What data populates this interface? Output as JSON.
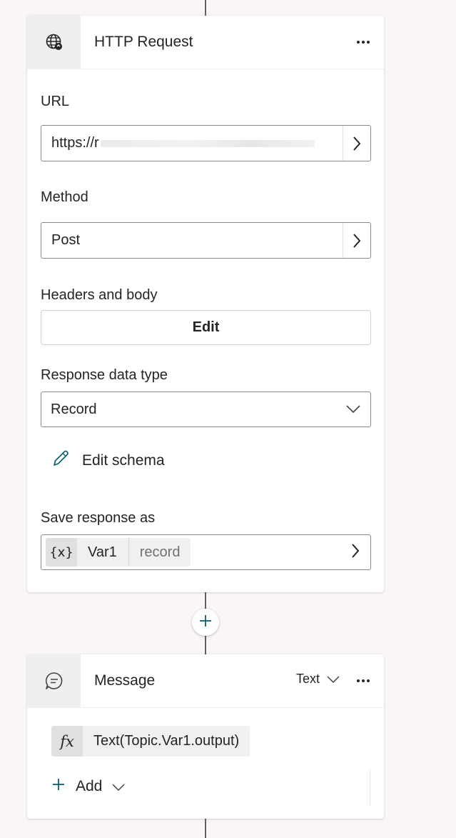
{
  "http_request": {
    "title": "HTTP Request",
    "url_label": "URL",
    "url_value": "https://r",
    "method_label": "Method",
    "method_value": "Post",
    "headers_label": "Headers and body",
    "edit_label": "Edit",
    "response_type_label": "Response data type",
    "response_type_value": "Record",
    "edit_schema_label": "Edit schema",
    "save_response_label": "Save response as",
    "var_icon": "{x}",
    "var_name": "Var1",
    "var_type": "record"
  },
  "message": {
    "title": "Message",
    "type_label": "Text",
    "fx_icon": "fx",
    "expression": "Text(Topic.Var1.output)",
    "add_label": "Add"
  },
  "icons": {
    "http": "globe-icon",
    "message": "chat-bubble-icon",
    "more": "more-icon",
    "chevron_right": "chevron-right-icon",
    "chevron_down": "chevron-down-icon",
    "pencil": "pencil-icon",
    "plus": "plus-icon"
  },
  "colors": {
    "background": "#faf6f5",
    "accent": "#0f6cbd",
    "connector": "#616161"
  }
}
